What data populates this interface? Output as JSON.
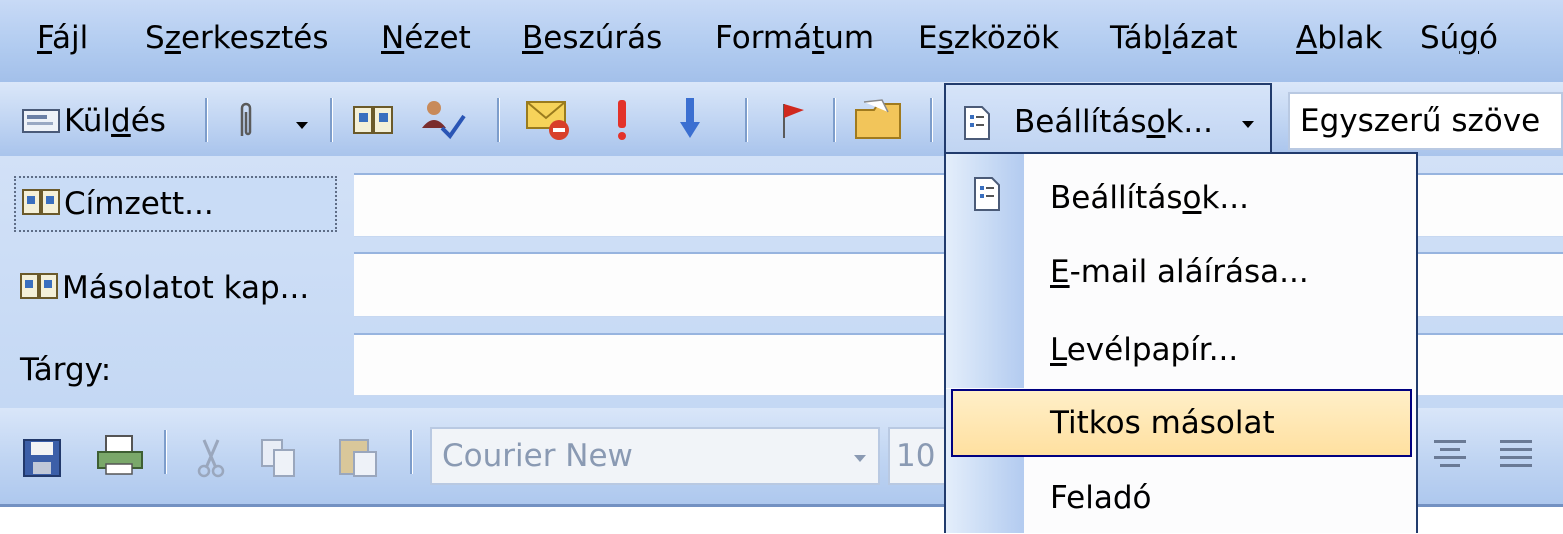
{
  "menubar": {
    "items": [
      {
        "pre": "",
        "key": "F",
        "post": "ájl"
      },
      {
        "pre": "S",
        "key": "z",
        "post": "erkesztés"
      },
      {
        "pre": "",
        "key": "N",
        "post": "ézet"
      },
      {
        "pre": "",
        "key": "B",
        "post": "eszúrás"
      },
      {
        "pre": "Formá",
        "key": "t",
        "post": "um"
      },
      {
        "pre": "E",
        "key": "s",
        "post": "zközök"
      },
      {
        "pre": "Táb",
        "key": "l",
        "post": "ázat"
      },
      {
        "pre": "",
        "key": "A",
        "post": "blak"
      },
      {
        "pre": "Sú",
        "key": "g",
        "post": "ó"
      }
    ]
  },
  "toolbar": {
    "send": {
      "pre": "Kül",
      "key": "d",
      "post": "és",
      "icon": "send-mail-icon"
    },
    "attach_icon": "paperclip-icon",
    "address_book_icon": "address-book-icon",
    "check_names_icon": "check-names-icon",
    "permission_icon": "permission-envelope-icon",
    "high_importance_icon": "high-importance-icon",
    "low_importance_icon": "low-importance-icon",
    "flag_icon": "flag-icon",
    "open_folder_icon": "folder-icon",
    "options": {
      "pre": "Beállítás",
      "key": "o",
      "post": "k...",
      "icon": "options-icon"
    },
    "format_combo": "Egyszerű szöve"
  },
  "header": {
    "to_label": "Címzett...",
    "cc_label": "Másolatot kap...",
    "subject_label": "Tárgy:",
    "to_value": "",
    "cc_value": "",
    "subject_value": ""
  },
  "format_toolbar": {
    "font": "Courier New",
    "size": "10"
  },
  "dropdown": {
    "items": [
      {
        "pre": "Beállítás",
        "key": "o",
        "post": "k...",
        "icon": "options-icon"
      },
      {
        "pre": "",
        "key": "E",
        "post": "-mail aláírása..."
      },
      {
        "pre": "",
        "key": "L",
        "post": "evélpapír..."
      },
      {
        "pre": "",
        "key": "",
        "post": "Titkos másolat"
      },
      {
        "pre": "",
        "key": "",
        "post": "Feladó"
      }
    ],
    "highlighted_index": 3,
    "highlight_color": "#ffe4a8"
  }
}
